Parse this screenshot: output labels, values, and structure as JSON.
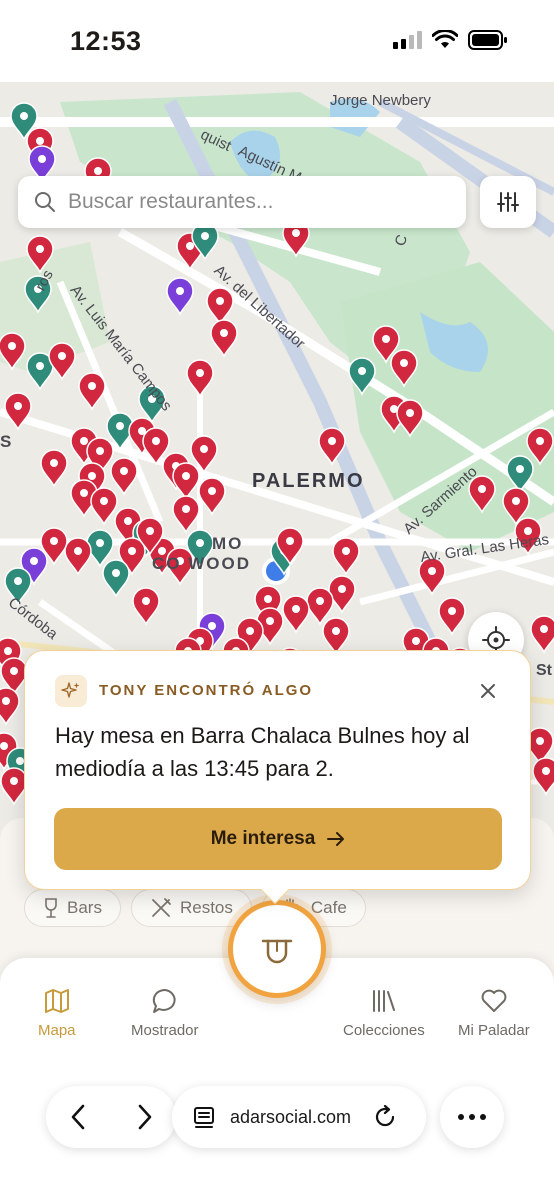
{
  "status_bar": {
    "time": "12:53"
  },
  "map": {
    "district": "PALERMO",
    "streets": {
      "newbery": "Jorge Newbery",
      "quist": "quist",
      "agustin": "Agustín M",
      "luis_maria_campos": "Av. Luis María Campos",
      "del_libertador": "Av. del Libertador",
      "ros": "ros",
      "sarmiento": "Av. Sarmiento",
      "las_heras": "Av. Gral. Las Heras",
      "cordoba": "Córdoba",
      "c": "C",
      "s": "S",
      "mo": "MO",
      "wood": "CO WOOD",
      "st": "St"
    }
  },
  "search": {
    "placeholder": "Buscar restaurantes..."
  },
  "chips": [
    {
      "label": "Bars",
      "icon": "wine-glass-icon"
    },
    {
      "label": "Restos",
      "icon": "fork-knife-icon"
    },
    {
      "label": "Cafe",
      "icon": "coffee-cup-icon"
    }
  ],
  "card": {
    "title": "TONY ENCONTRÓ ALGO",
    "message": "Hay mesa en Barra Chalaca Bulnes hoy al mediodía a las 13:45 para 2.",
    "cta_label": "Me interesa",
    "cta_icon": "arrow-right-icon",
    "icon": "sparkles-icon"
  },
  "nav": {
    "items": [
      {
        "label": "Mapa",
        "icon": "map-icon",
        "active": true
      },
      {
        "label": "Mostrador",
        "icon": "chat-bubble-icon",
        "active": false
      },
      {
        "label": "Colecciones",
        "icon": "library-icon",
        "active": false
      },
      {
        "label": "Mi Paladar",
        "icon": "heart-icon",
        "active": false
      }
    ],
    "center_icon": "tongue-face-icon"
  },
  "browser": {
    "url": "adarsocial.com"
  },
  "colors": {
    "pin_red": "#d2283f",
    "pin_teal": "#2f8c7a",
    "pin_purple": "#7a3fd8",
    "accent_gold": "#dba94a",
    "active_nav": "#c79a3b"
  }
}
